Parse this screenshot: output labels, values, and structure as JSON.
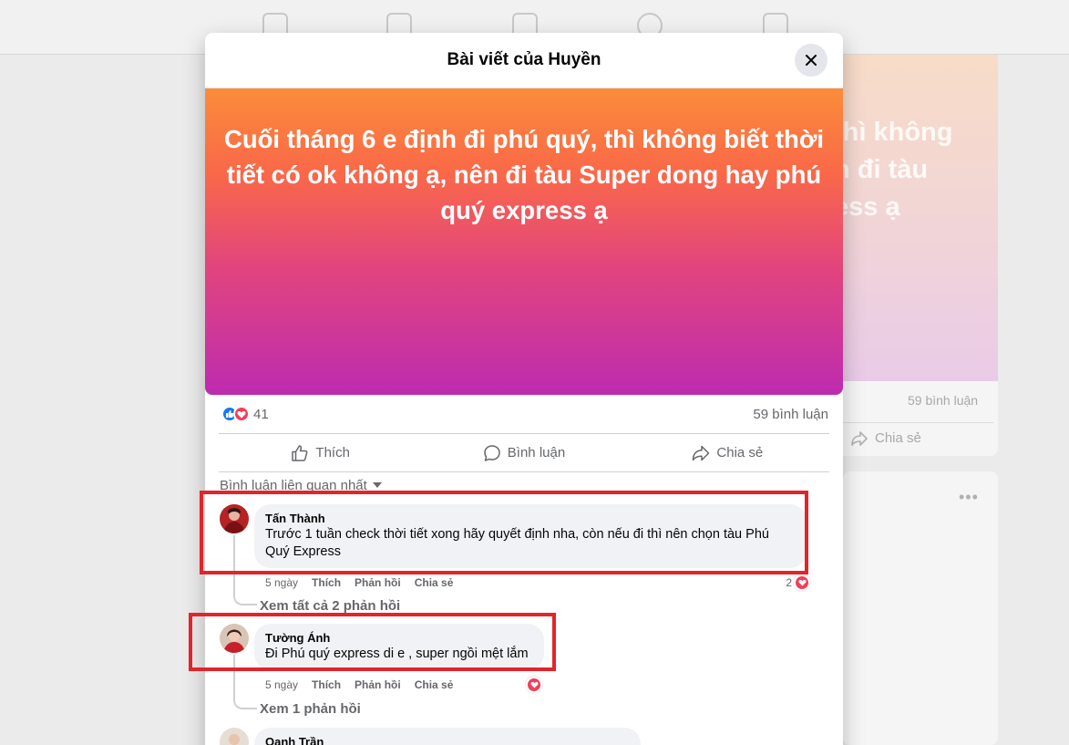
{
  "background": {
    "post_text": "thì không\nn đi tàu\ness ạ",
    "comment_count": "59 bình luận",
    "share_label": "Chia sẻ"
  },
  "modal": {
    "title": "Bài viết của Huyền",
    "post_text": "Cuối tháng 6 e định đi phú quý, thì không biết thời tiết có ok không ạ, nên đi tàu Super dong hay phú quý express ạ",
    "gradient": [
      "#fb8c3a",
      "#fa6849",
      "#e2457d",
      "#bd2bb0"
    ],
    "reaction_count": "41",
    "comment_count": "59 bình luận",
    "actions": {
      "like": "Thích",
      "comment": "Bình luận",
      "share": "Chia sẻ"
    },
    "sort_label": "Bình luận liên quan nhất"
  },
  "comments": [
    {
      "name": "Tấn Thành",
      "text": "Trước 1 tuần check thời tiết xong hãy quyết định nha, còn nếu đi thì nên chọn tàu Phú Quý Express",
      "time": "5 ngày",
      "like": "Thích",
      "reply": "Phản hồi",
      "share": "Chia sẻ",
      "reaction_count": "2",
      "view_replies": "Xem tất cả 2 phản hồi"
    },
    {
      "name": "Tường Ánh",
      "text": "Đi Phú quý express di e , super ngồi mệt lắm",
      "time": "5 ngày",
      "like": "Thích",
      "reply": "Phản hồi",
      "share": "Chia sẻ",
      "view_replies": "Xem 1 phản hồi"
    },
    {
      "name": "Oanh Trần"
    }
  ],
  "colors": {
    "highlight": "#e0252b",
    "like_blue": "#1877f2",
    "heart_red": "#f33e58"
  }
}
